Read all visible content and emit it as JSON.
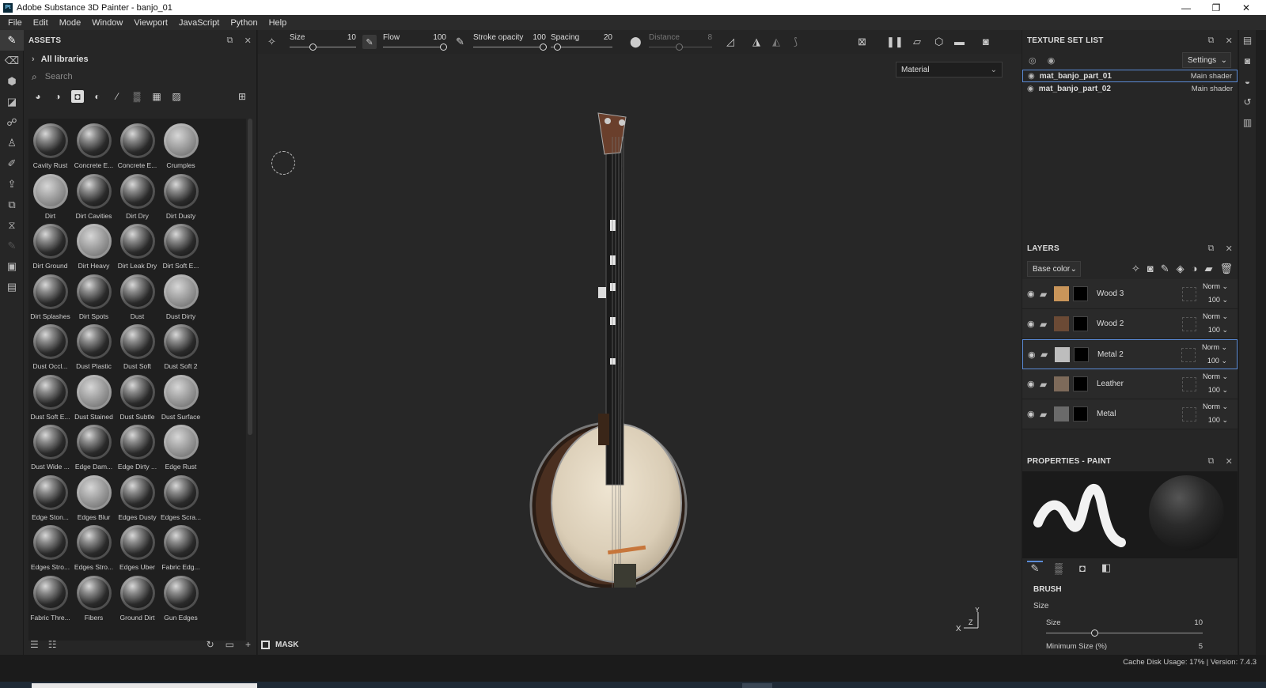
{
  "window": {
    "title": "Adobe Substance 3D Painter - banjo_01",
    "app_icon": "Pt"
  },
  "menu": [
    "File",
    "Edit",
    "Mode",
    "Window",
    "Viewport",
    "JavaScript",
    "Python",
    "Help"
  ],
  "assets": {
    "title": "ASSETS",
    "library": "All libraries",
    "search_placeholder": "Search",
    "items": [
      [
        "Cavity Rust",
        "Concrete E...",
        "Concrete E...",
        "Crumples"
      ],
      [
        "Dirt",
        "Dirt Cavities",
        "Dirt Dry",
        "Dirt Dusty"
      ],
      [
        "Dirt Ground",
        "Dirt Heavy",
        "Dirt Leak Dry",
        "Dirt Soft E..."
      ],
      [
        "Dirt Splashes",
        "Dirt Spots",
        "Dust",
        "Dust Dirty"
      ],
      [
        "Dust Occl...",
        "Dust Plastic",
        "Dust Soft",
        "Dust Soft 2"
      ],
      [
        "Dust Soft E...",
        "Dust Stained",
        "Dust Subtle",
        "Dust Surface"
      ],
      [
        "Dust Wide ...",
        "Edge Dam...",
        "Edge Dirty ...",
        "Edge Rust"
      ],
      [
        "Edge Ston...",
        "Edges Blur",
        "Edges Dusty",
        "Edges Scra..."
      ],
      [
        "Edges Stro...",
        "Edges Stro...",
        "Edges Uber",
        "Fabric Edg..."
      ],
      [
        "Fabric Thre...",
        "Fibers",
        "Ground Dirt",
        "Gun Edges"
      ]
    ]
  },
  "toolbar": {
    "size_label": "Size",
    "size_value": "10",
    "flow_label": "Flow",
    "flow_value": "100",
    "stroke_label": "Stroke opacity",
    "stroke_value": "100",
    "spacing_label": "Spacing",
    "spacing_value": "20",
    "distance_label": "Distance",
    "distance_value": "8"
  },
  "viewport": {
    "material_mode": "Material",
    "mask_label": "MASK"
  },
  "texture_set_list": {
    "title": "TEXTURE SET LIST",
    "settings": "Settings",
    "items": [
      {
        "name": "mat_banjo_part_01",
        "shader": "Main shader"
      },
      {
        "name": "mat_banjo_part_02",
        "shader": "Main shader"
      }
    ]
  },
  "layers": {
    "title": "LAYERS",
    "channel": "Base color",
    "items": [
      {
        "name": "Wood 3",
        "blend": "Norm",
        "opacity": "100",
        "color": "#c9955a"
      },
      {
        "name": "Wood 2",
        "blend": "Norm",
        "opacity": "100",
        "color": "#6b4a35"
      },
      {
        "name": "Metal 2",
        "blend": "Norm",
        "opacity": "100",
        "color": "#bdbdbd"
      },
      {
        "name": "Leather",
        "blend": "Norm",
        "opacity": "100",
        "color": "#7d6a5a"
      },
      {
        "name": "Metal",
        "blend": "Norm",
        "opacity": "100",
        "color": "#6a6a6a"
      }
    ]
  },
  "properties": {
    "title": "PROPERTIES - PAINT",
    "section": "BRUSH",
    "subsection": "Size",
    "size_label": "Size",
    "size_value": "10",
    "min_size_label": "Minimum Size (%)",
    "min_size_value": "5"
  },
  "status": {
    "text": "Cache Disk Usage:   17% | Version: 7.4.3"
  },
  "colors": {
    "accent": "#5b8bd6",
    "panel": "#262626",
    "viewport": "#272727"
  }
}
